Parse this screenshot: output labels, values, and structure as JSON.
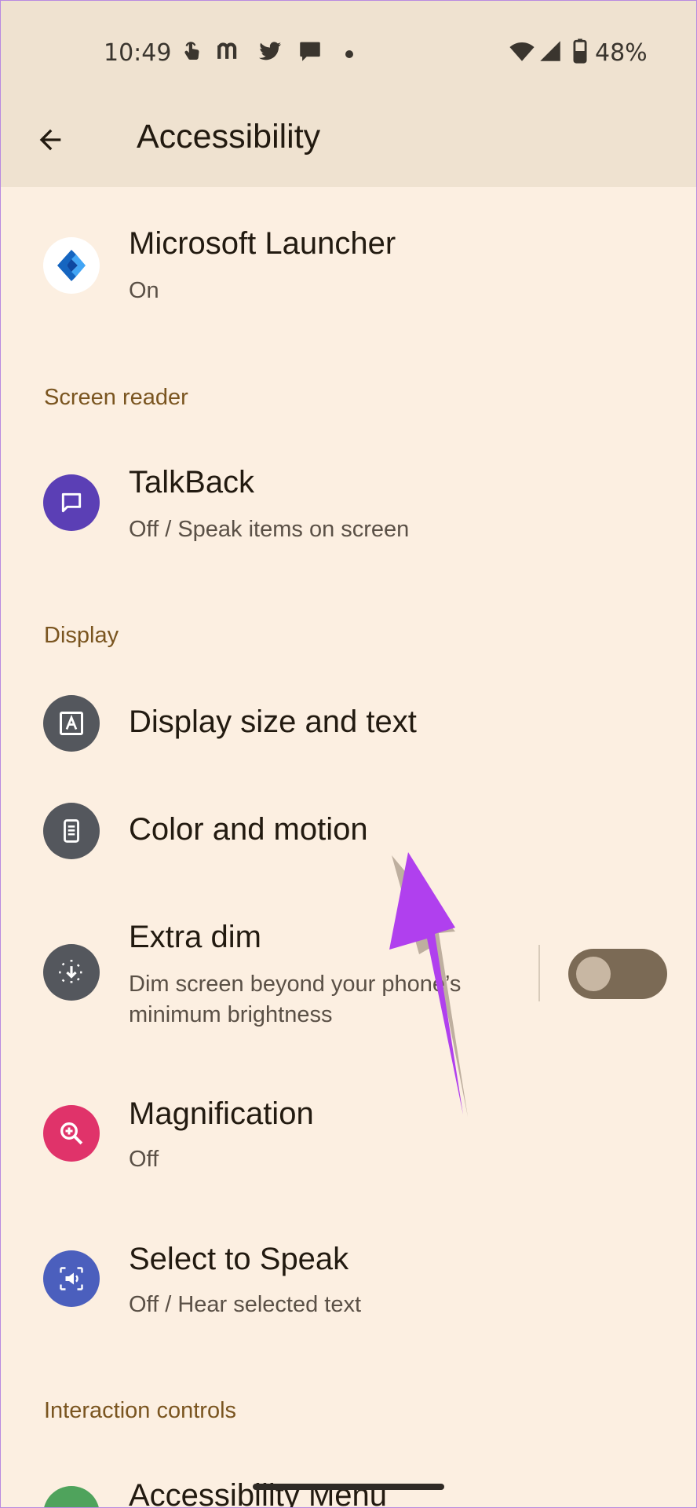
{
  "status_bar": {
    "time": "10:49",
    "notification_icons": [
      "touch-icon",
      "m-app-icon",
      "twitter-icon",
      "chat-icon"
    ],
    "battery": "48%"
  },
  "header": {
    "title": "Accessibility",
    "back_icon": "arrow-left-icon"
  },
  "apps": [
    {
      "title": "Microsoft Launcher",
      "subtitle": "On"
    }
  ],
  "sections": {
    "screen_reader": "Screen reader",
    "display": "Display",
    "interaction_controls": "Interaction controls"
  },
  "items": {
    "talkback": {
      "title": "TalkBack",
      "subtitle": "Off / Speak items on screen",
      "icon": "message-icon",
      "color": "#5b3fb5"
    },
    "display_size": {
      "title": "Display size and text",
      "icon": "text-size-icon",
      "color": "#54575d"
    },
    "color_motion": {
      "title": "Color and motion",
      "icon": "phone-list-icon",
      "color": "#54575d"
    },
    "extra_dim": {
      "title": "Extra dim",
      "subtitle_line1": "Dim screen beyond your phone’s",
      "subtitle_line2": "minimum brightness",
      "icon": "dim-icon",
      "color": "#54575d",
      "toggle_on": false
    },
    "magnification": {
      "title": "Magnification",
      "subtitle": "Off",
      "icon": "zoom-icon",
      "color": "#e0336a"
    },
    "select_to_speak": {
      "title": "Select to Speak",
      "subtitle": "Off / Hear selected text",
      "icon": "speaker-icon",
      "color": "#4b5fbd"
    },
    "accessibility_menu": {
      "title": "Accessibility Menu",
      "icon": "menu-icon",
      "color": "#4fa35c"
    }
  },
  "annotation": {
    "arrow_color": "#b040ee"
  }
}
